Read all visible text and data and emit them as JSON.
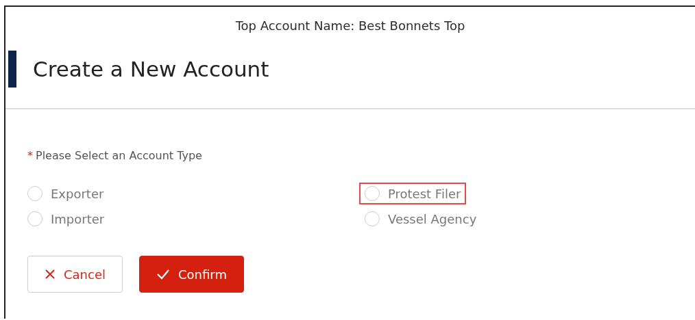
{
  "top_account": "Top Account Name: Best Bonnets Top",
  "title": "Create a New Account",
  "account_type": {
    "label": "Please Select an Account Type",
    "required_mark": "*",
    "options": [
      {
        "label": "Exporter",
        "selected": false,
        "highlighted": false
      },
      {
        "label": "Protest Filer",
        "selected": false,
        "highlighted": true
      },
      {
        "label": "Importer",
        "selected": false,
        "highlighted": false
      },
      {
        "label": "Vessel Agency",
        "selected": false,
        "highlighted": false
      }
    ]
  },
  "buttons": [
    {
      "kind": "cancel",
      "label": "Cancel"
    },
    {
      "kind": "confirm",
      "label": "Confirm"
    }
  ]
}
